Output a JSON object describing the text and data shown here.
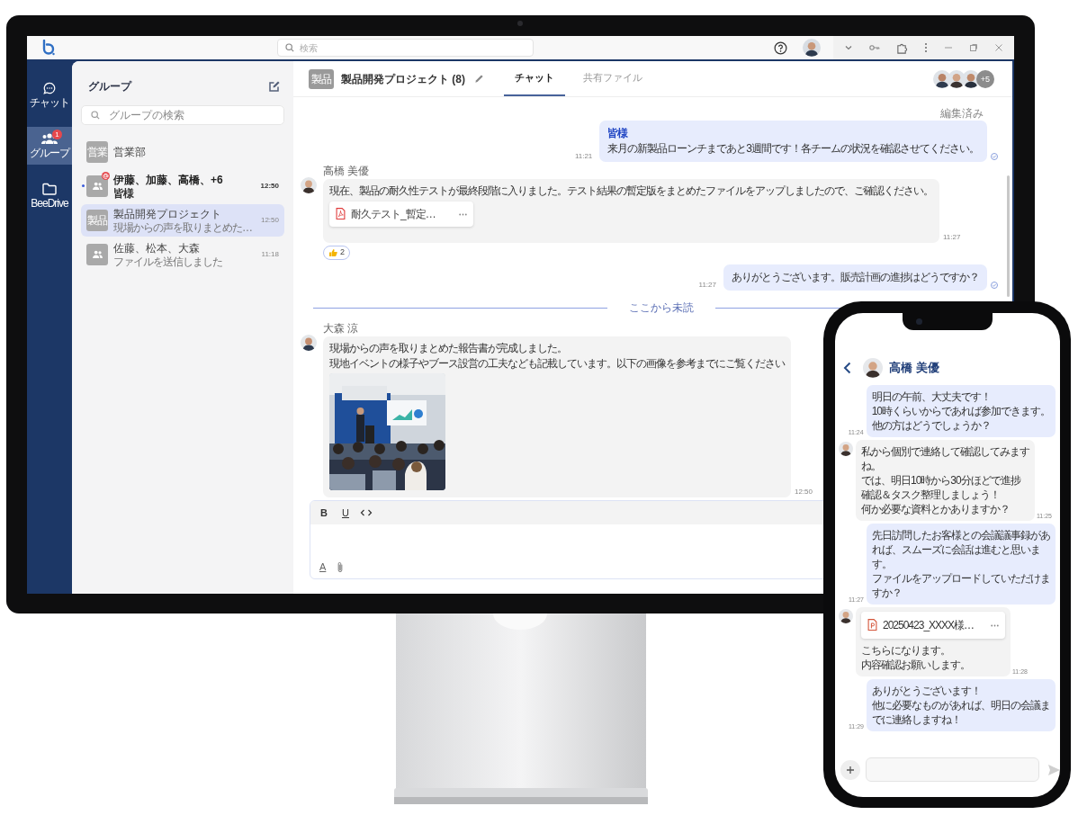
{
  "desktop": {
    "search_placeholder": "検索",
    "nav": [
      {
        "kind": "chat",
        "label": "チャット",
        "selected": false
      },
      {
        "kind": "group",
        "label": "グループ",
        "selected": true,
        "badge": "1"
      },
      {
        "kind": "folder",
        "label": "BeeDrive",
        "selected": false
      }
    ],
    "groups": {
      "title": "グループ",
      "search_placeholder": "グループの検索",
      "items": [
        {
          "avatar": {
            "kind": "text",
            "text": "営業"
          },
          "name": "営業部",
          "selected": false,
          "unread": false,
          "mention": false
        },
        {
          "avatar": {
            "kind": "people"
          },
          "name": "伊藤、加藤、高橋、+6",
          "preview": "皆様",
          "time": "12:50",
          "selected": false,
          "unread": true,
          "mention": true
        },
        {
          "avatar": {
            "kind": "text",
            "text": "製品"
          },
          "name": "製品開発プロジェクト",
          "preview": "現場からの声を取りまとめた…",
          "time": "12:50",
          "selected": true,
          "unread": false,
          "mention": false
        },
        {
          "avatar": {
            "kind": "people"
          },
          "name": "佐藤、松本、大森",
          "preview": "ファイルを送信しました",
          "time": "11:18",
          "selected": false,
          "unread": false,
          "mention": false
        }
      ]
    },
    "chat": {
      "avatar_text": "製品",
      "title": "製品開発プロジェクト (8)",
      "tabs": [
        {
          "label": "チャット",
          "selected": true
        },
        {
          "label": "共有ファイル",
          "selected": false
        }
      ],
      "more_members": "+5",
      "messages": [
        {
          "kind": "own",
          "edited_label": "編集済み",
          "mention": "皆様",
          "lines": [
            "来月の新製品ローンチまであと3週間です！各チームの状況を確認させてください。"
          ],
          "time": "11:21",
          "read": true
        },
        {
          "kind": "other",
          "sender": "高橋 美優",
          "lines": [
            "現在、製品の耐久性テストが最終段階に入りました。テスト結果の暫定版をまとめたファイルをアップしましたので、ご確認ください。"
          ],
          "attachment": {
            "kind": "pdf",
            "name": "耐久テスト_暫定…"
          },
          "time": "11:27",
          "reaction_count": "2"
        },
        {
          "kind": "own",
          "lines": [
            "ありがとうございます。販売計画の進捗はどうですか？"
          ],
          "time": "11:27",
          "read": true
        },
        {
          "kind": "divider",
          "label": "ここから未読"
        },
        {
          "kind": "other",
          "sender": "大森 涼",
          "lines": [
            "現場からの声を取りまとめた報告書が完成しました。",
            "現地イベントの様子やブース設営の工夫なども記載しています。以下の画像を参考までにご覧ください"
          ],
          "image": {
            "kind": "picture"
          },
          "time": "12:50"
        }
      ],
      "composer": {
        "format_buttons": [
          {
            "kind": "bold",
            "label": "B"
          },
          {
            "kind": "underline",
            "label": "U"
          },
          {
            "kind": "code"
          }
        ],
        "text_color_label": "A"
      }
    }
  },
  "phone": {
    "contact": "高橋 美優",
    "messages": [
      {
        "kind": "own",
        "lines": [
          "明日の午前、大丈夫です！",
          "10時くらいからであれば参加できます。",
          "他の方はどうでしょうか？"
        ],
        "time": "11:24"
      },
      {
        "kind": "other",
        "lines": [
          "私から個別で連絡して確認してみます",
          "ね。",
          "では、明日10時から30分ほどで進捗",
          "確認＆タスク整理しましょう！",
          "何か必要な資料とかありますか？"
        ],
        "time": "11:25"
      },
      {
        "kind": "own",
        "lines": [
          "先日訪問したお客様との会議議事録があ",
          "れば、スムーズに会話は進むと思いま",
          "す。",
          "ファイルをアップロードしていただけま",
          "すか？"
        ],
        "time": "11:27"
      },
      {
        "kind": "other",
        "attachment": {
          "kind": "ppt",
          "name": "20250423_XXXX様…"
        },
        "lines": [
          "こちらになります。",
          "内容確認お願いします。"
        ],
        "time": "11:28"
      },
      {
        "kind": "own",
        "lines": [
          "ありがとうございます！",
          "他に必要なものがあれば、明日の会議ま",
          "でに連絡しますね！"
        ],
        "time": "11:29"
      }
    ]
  }
}
